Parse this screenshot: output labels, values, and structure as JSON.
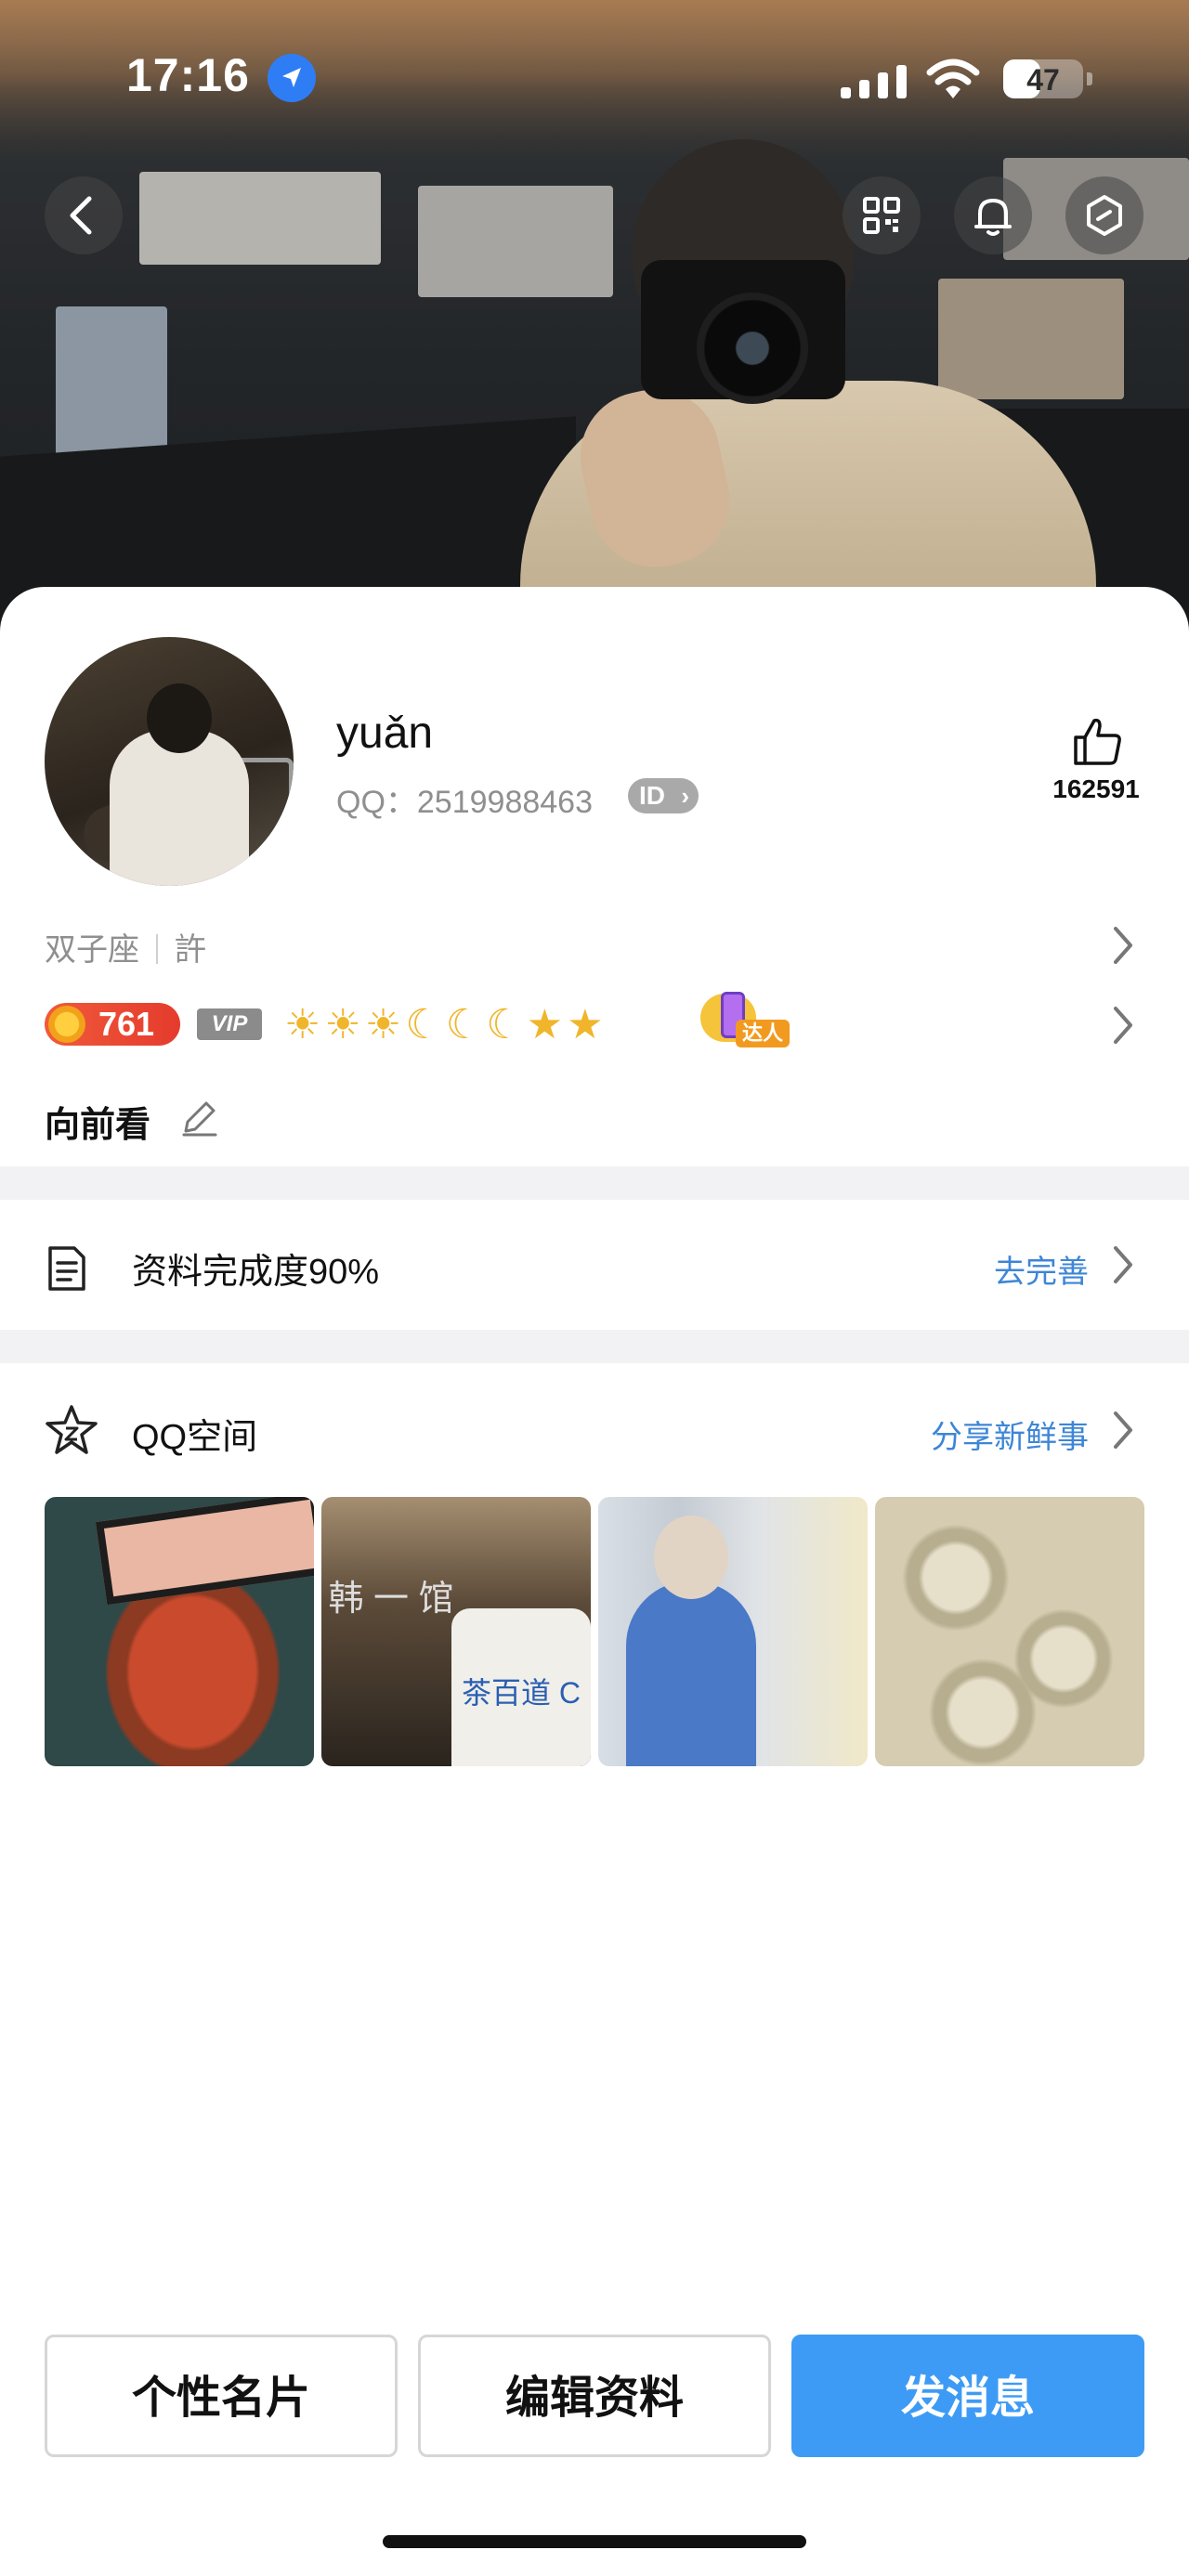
{
  "status_bar": {
    "time": "17:16",
    "battery": "47",
    "battery_level": 0.47
  },
  "header": {
    "back_icon": "chevron-left-icon",
    "action_icons": [
      "qr-code-icon",
      "bell-icon",
      "hexagon-settings-icon"
    ]
  },
  "profile": {
    "name": "yuǎn",
    "qq_label": "QQ：2519988463",
    "id_badge": "ID",
    "like_count": "162591",
    "tags": [
      "双子座",
      "許"
    ],
    "coin_value": "761",
    "vip_label": "VIP",
    "level_icons": "☀☀☀☾☾☾★★",
    "daren_label": "达人",
    "signature": "向前看"
  },
  "rows": {
    "completion": {
      "label": "资料完成度90%",
      "link": "去完善"
    },
    "qzone": {
      "label": "QQ空间",
      "link": "分享新鲜事"
    }
  },
  "photos": {
    "p2_shop_text": "韩 一 馆",
    "p2_cup_text": "茶百道 C"
  },
  "buttons": {
    "card": "个性名片",
    "edit": "编辑资料",
    "message": "发消息"
  },
  "colors": {
    "accent_blue": "#3d9bf5",
    "link_blue": "#3d86d6",
    "coin_red": "#e53b2d",
    "divider": "#f2f2f4"
  }
}
